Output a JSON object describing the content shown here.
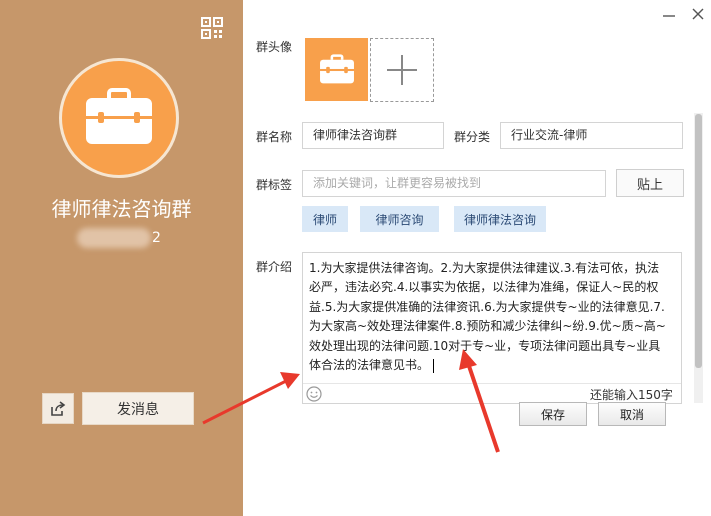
{
  "left_panel": {
    "group_name": "律师律法咨询群",
    "group_id_suffix": "2",
    "send_message_label": "发消息",
    "qr_icon": "qr-code-icon",
    "share_icon": "share-icon",
    "avatar_icon": "briefcase-icon",
    "bg_color": "#c6976a",
    "avatar_color": "#f8a04b"
  },
  "form": {
    "avatar_label": "群头像",
    "name_label": "群名称",
    "name_value": "律师律法咨询群",
    "category_label": "群分类",
    "category_value": "行业交流-律师",
    "tags_label": "群标签",
    "tags_placeholder": "添加关键词，让群更容易被找到",
    "paste_label": "贴上",
    "tags": [
      "律师",
      "律师咨询",
      "律师律法咨询"
    ],
    "intro_label": "群介绍",
    "intro_text": "1.为大家提供法律咨询。2.为大家提供法律建议.3.有法可依，执法必严，违法必究.4.以事实为依据，以法律为准绳，保证人~民的权益.5.为大家提供准确的法律资讯.6.为大家提供专~业的法律意见.7.为大家高~效处理法律案件.8.预防和减少法律纠~纷.9.优~质~高~效处理出现的法律问题.10对于专~业，专项法律问题出具专~业具体合法的法律意见书。",
    "remaining_text": "还能输入150字",
    "save_label": "保存",
    "cancel_label": "取消",
    "emoji_icon": "smiley-icon"
  },
  "window": {
    "minimize_icon": "minimize-icon",
    "close_icon": "close-icon"
  },
  "annotation_color": "#e8392c"
}
